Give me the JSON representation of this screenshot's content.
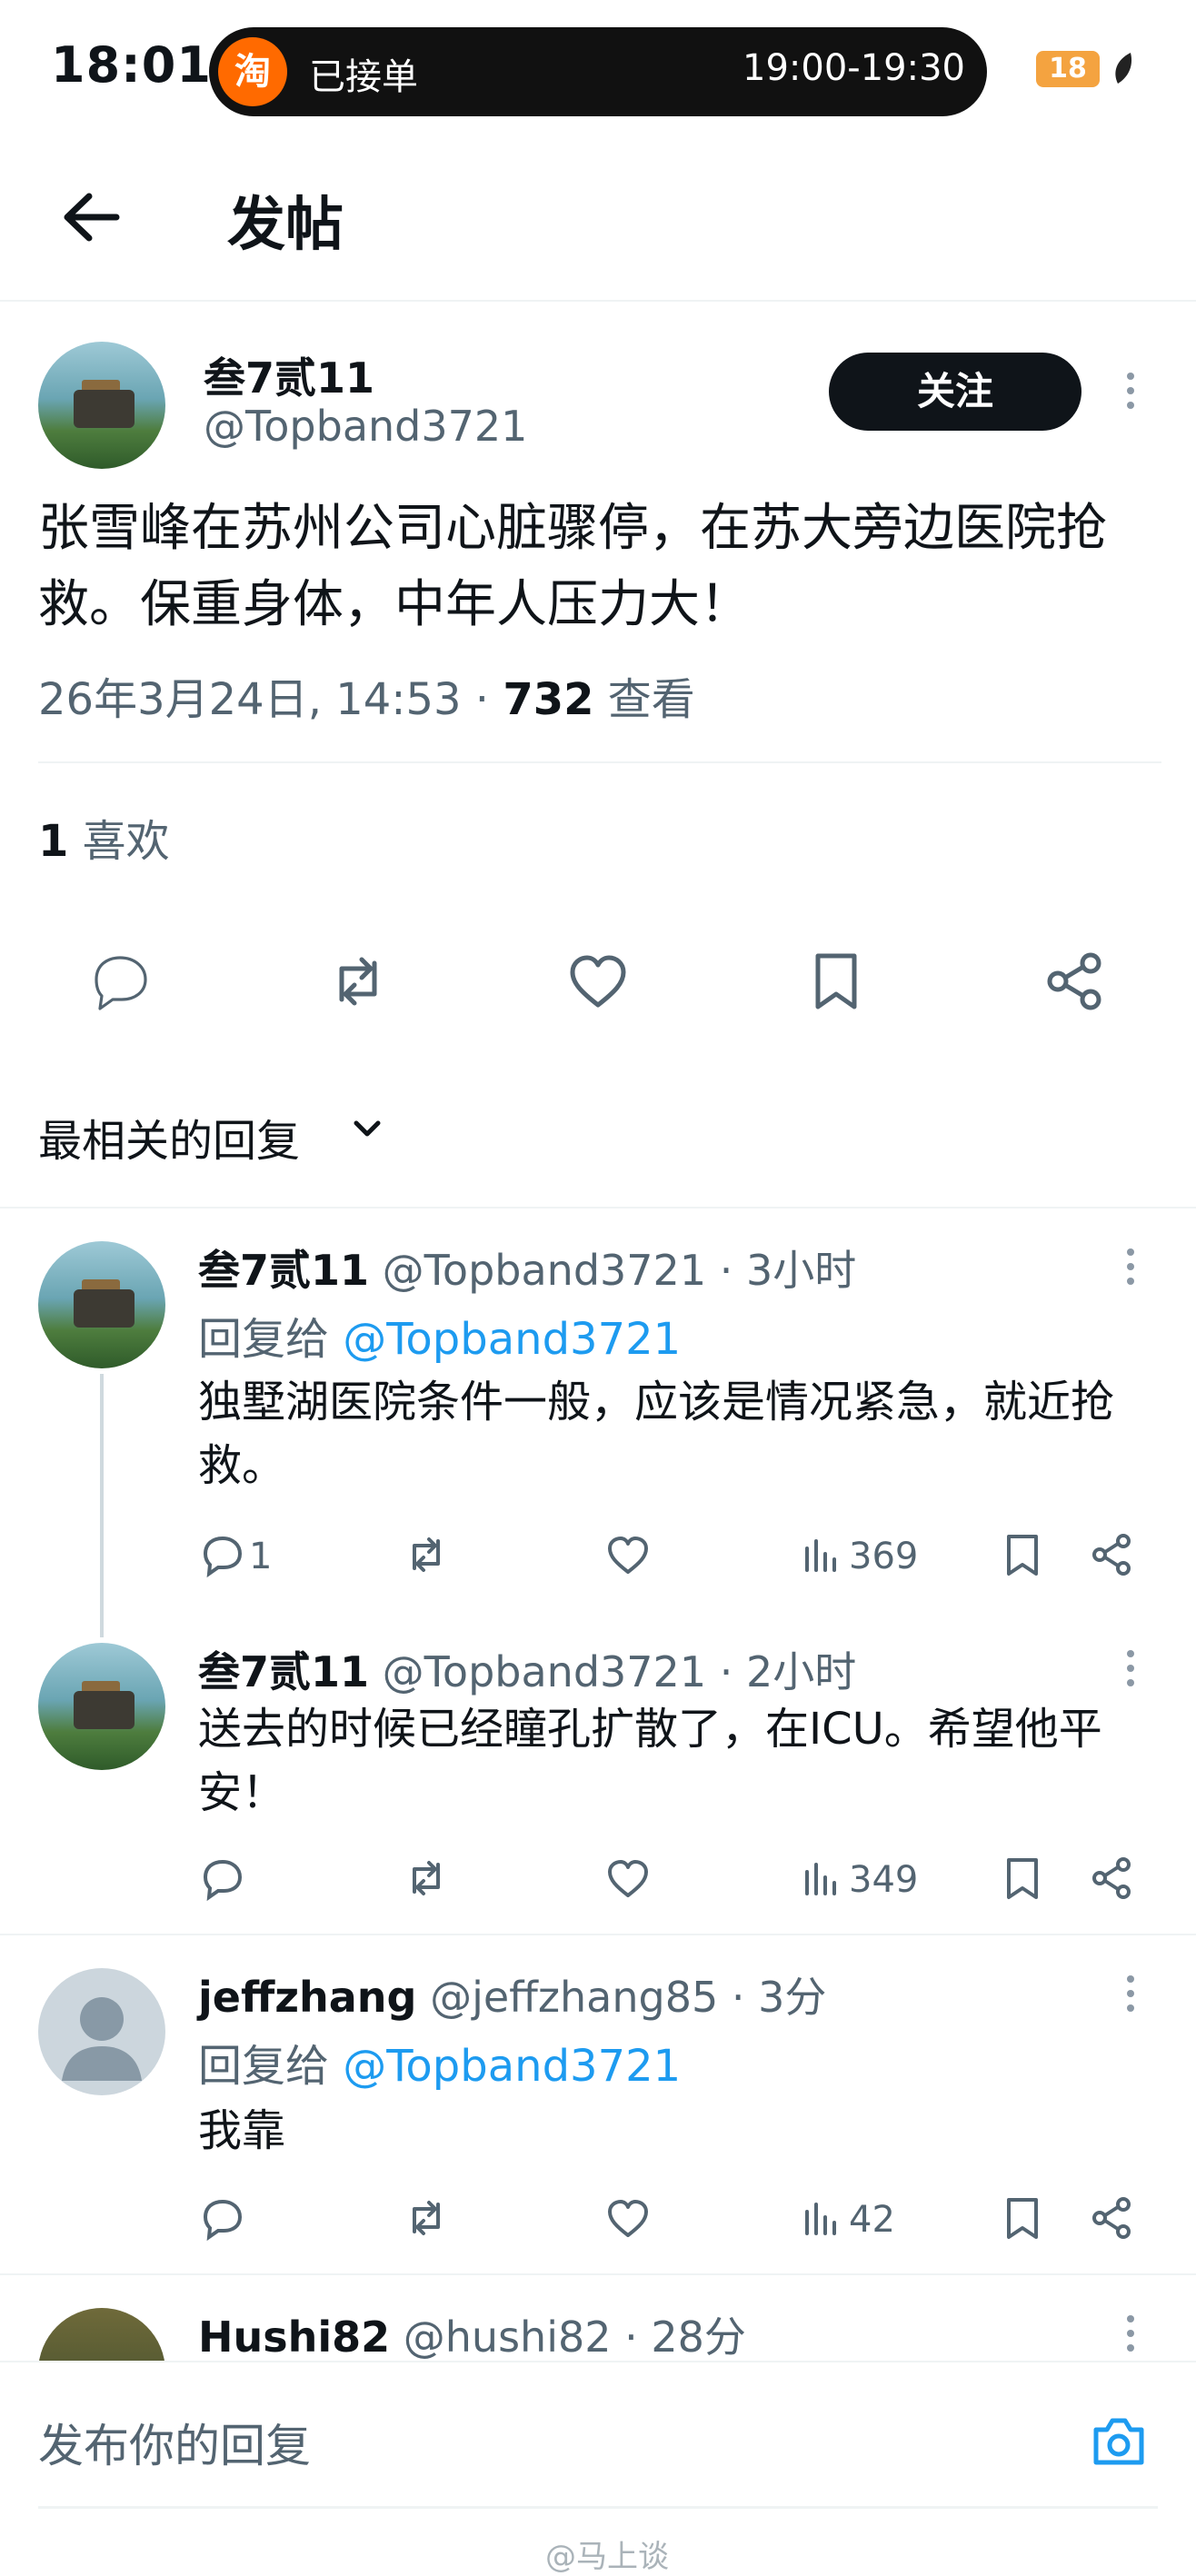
{
  "status_bar": {
    "time": "18:01",
    "app_badge": "淘",
    "order_status": "已接单",
    "order_time": "19:00-19:30",
    "battery": "18"
  },
  "header": {
    "title": "发帖"
  },
  "post": {
    "author_name": "叁7贰11",
    "author_handle": "@Topband3721",
    "follow_label": "关注",
    "text": "张雪峰在苏州公司心脏骤停，在苏大旁边医院抢救。保重身体，中年人压力大！",
    "timestamp": "26年3月24日, 14:53 · ",
    "views": "732",
    "views_label": " 查看",
    "likes": "1",
    "likes_label": " 喜欢"
  },
  "sort": {
    "label": "最相关的回复"
  },
  "replies": [
    {
      "name": "叁7贰11",
      "handle_time": " @Topband3721 · 3小时",
      "reply_prefix": "回复给 ",
      "reply_to": "@Topband3721",
      "text": "独墅湖医院条件一般，应该是情况紧急，就近抢救。",
      "comments": "1",
      "views": "369"
    },
    {
      "name": "叁7贰11",
      "handle_time": " @Topband3721 · 2小时",
      "text": "送去的时候已经瞳孔扩散了，在ICU。希望他平安！",
      "views": "349"
    },
    {
      "name": "jeffzhang",
      "handle_time": " @jeffzhang85 · 3分",
      "reply_prefix": "回复给 ",
      "reply_to": "@Topband3721",
      "text": "我靠",
      "views": "42"
    },
    {
      "name": "Hushi82",
      "handle_time": " @hushi82 · 28分"
    }
  ],
  "composer": {
    "placeholder": "发布你的回复",
    "watermark": "@马上谈"
  },
  "icons": {
    "back": "arrow-left-icon",
    "reply": "comment-icon",
    "repost": "repost-icon",
    "like": "heart-icon",
    "bookmark": "bookmark-icon",
    "share": "share-icon",
    "views": "bar-chart-icon",
    "more": "kebab-icon",
    "camera": "camera-icon",
    "sort": "chevron-down-icon"
  },
  "colors": {
    "accent": "#1d9bf0",
    "text": "#0f1419",
    "muted": "#536471",
    "taobao": "#ff6a00"
  }
}
